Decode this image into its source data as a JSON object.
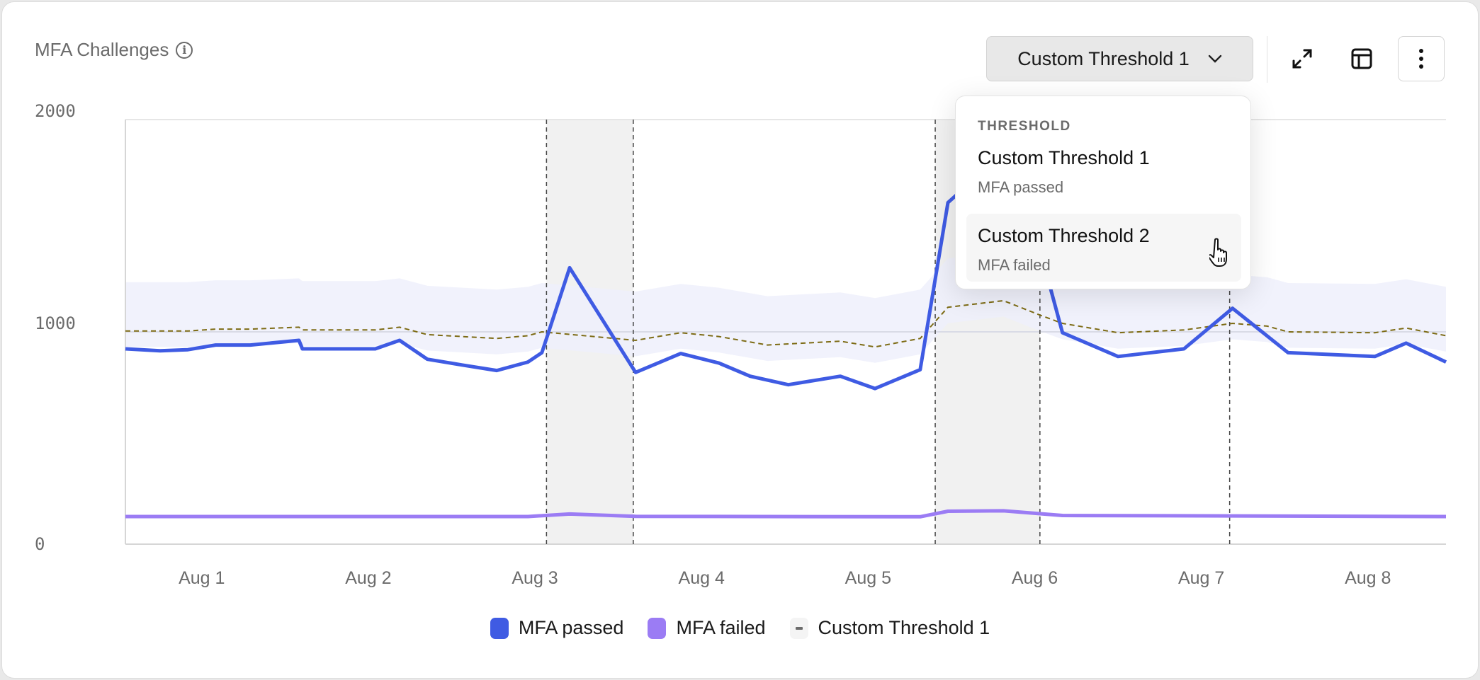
{
  "card": {
    "title": "MFA Challenges",
    "info_icon": "info-circle-icon"
  },
  "toolbar": {
    "threshold_select": {
      "value": "Custom Threshold 1",
      "icon": "chevron-down-icon"
    },
    "expand_icon": "expand-arrows-icon",
    "table_icon": "table-layout-icon",
    "more_icon": "vertical-ellipsis-icon"
  },
  "threshold_menu": {
    "header": "THRESHOLD",
    "items": [
      {
        "label": "Custom Threshold 1",
        "sublabel": "MFA passed"
      },
      {
        "label": "Custom Threshold 2",
        "sublabel": "MFA failed",
        "hovered": true
      }
    ],
    "cursor_icon": "hand-pointer-icon"
  },
  "chart_data": {
    "type": "line",
    "xlim": [
      "Jul 31 13:00",
      "Aug 8 11:15"
    ],
    "ylim": [
      0,
      2000
    ],
    "y_ticks": [
      "0",
      "1000",
      "2000"
    ],
    "x_ticks": [
      "Aug 1",
      "Aug 2",
      "Aug 3",
      "Aug 4",
      "Aug 5",
      "Aug 6",
      "Aug 7",
      "Aug 8"
    ],
    "grid": "horizontal line at 1000",
    "legend_placement": "bottom",
    "colors": {
      "passed": "#3f5be3",
      "failed": "#9b7cf4",
      "threshold": "#7d6b14",
      "band": "#eef0fb",
      "anomaly": "#f1f1f1"
    },
    "series": [
      {
        "name": "MFA passed",
        "x": [
          "Jul 31 13:00",
          "Jul 31 18:00",
          "Jul 31 22:00",
          "Aug 1 02:00",
          "Aug 1 07:00",
          "Aug 1 14:00",
          "Aug 1 14:30",
          "Aug 2 01:00",
          "Aug 2 04:30",
          "Aug 2 08:30",
          "Aug 2 13:30",
          "Aug 2 18:30",
          "Aug 2 23:00",
          "Aug 3 01:00",
          "Aug 3 05:00",
          "Aug 3 14:30",
          "Aug 3 21:00",
          "Aug 4 02:30",
          "Aug 4 07:00",
          "Aug 4 12:30",
          "Aug 4 20:00",
          "Aug 5 01:00",
          "Aug 5 07:30",
          "Aug 5 11:30",
          "Aug 5 13:00",
          "Aug 5 19:00",
          "Aug 5 23:00",
          "Aug 6 04:00",
          "Aug 6 12:00",
          "Aug 6 21:30",
          "Aug 7 04:30",
          "Aug 7 12:30",
          "Aug 8 01:00",
          "Aug 8 05:30",
          "Aug 8 11:15"
        ],
        "y": [
          920,
          911,
          916,
          938,
          938,
          960,
          920,
          920,
          960,
          871,
          844,
          818,
          858,
          902,
          1302,
          809,
          898,
          853,
          791,
          751,
          791,
          733,
          822,
          1609,
          1653,
          1700,
          1600,
          996,
          884,
          920,
          1111,
          902,
          884,
          947,
          858
        ]
      },
      {
        "name": "MFA failed",
        "x": [
          "Jul 31 13:00",
          "Aug 2 23:00",
          "Aug 3 05:00",
          "Aug 3 14:30",
          "Aug 5 07:30",
          "Aug 5 11:30",
          "Aug 5 19:30",
          "Aug 6 04:00",
          "Aug 8 11:15"
        ],
        "y": [
          130,
          130,
          142,
          131,
          129,
          155,
          157,
          135,
          130
        ]
      },
      {
        "name": "Custom Threshold 1",
        "x": [
          "Jul 31 13:00",
          "Jul 31 22:00",
          "Aug 1 02:00",
          "Aug 1 07:00",
          "Aug 1 14:00",
          "Aug 1 14:30",
          "Aug 2 01:00",
          "Aug 2 04:30",
          "Aug 2 08:30",
          "Aug 2 18:30",
          "Aug 2 23:00",
          "Aug 3 01:00",
          "Aug 3 14:30",
          "Aug 3 21:00",
          "Aug 4 02:30",
          "Aug 4 09:30",
          "Aug 4 20:00",
          "Aug 5 01:00",
          "Aug 5 07:30",
          "Aug 5 11:30",
          "Aug 5 19:30",
          "Aug 6 01:00",
          "Aug 6 04:00",
          "Aug 6 12:00",
          "Aug 6 21:30",
          "Aug 7 04:30",
          "Aug 7 09:30",
          "Aug 7 12:30",
          "Aug 8 01:00",
          "Aug 8 05:30",
          "Aug 8 11:15"
        ],
        "y": [
          1004,
          1004,
          1013,
          1013,
          1022,
          1009,
          1009,
          1022,
          987,
          969,
          982,
          1000,
          960,
          996,
          978,
          938,
          956,
          929,
          969,
          1116,
          1147,
          1076,
          1040,
          996,
          1009,
          1040,
          1027,
          1000,
          996,
          1018,
          982
        ],
        "band_upper": [
          1234,
          1234,
          1243,
          1243,
          1252,
          1239,
          1239,
          1252,
          1217,
          1199,
          1212,
          1230,
          1190,
          1226,
          1208,
          1168,
          1186,
          1159,
          1199,
          1346,
          1377,
          1306,
          1270,
          1226,
          1239,
          1270,
          1257,
          1230,
          1226,
          1248,
          1212
        ],
        "band_lower": [
          929,
          929,
          938,
          938,
          947,
          934,
          934,
          947,
          912,
          894,
          907,
          925,
          885,
          921,
          903,
          863,
          881,
          854,
          894,
          1041,
          1072,
          1001,
          965,
          921,
          934,
          965,
          952,
          925,
          921,
          943,
          907
        ]
      }
    ],
    "anomaly_regions": [
      [
        "Aug 3 01:40",
        "Aug 3 14:10"
      ],
      [
        "Aug 5 09:40",
        "Aug 6 00:45"
      ]
    ],
    "markers": [
      "Aug 7 04:05"
    ]
  }
}
